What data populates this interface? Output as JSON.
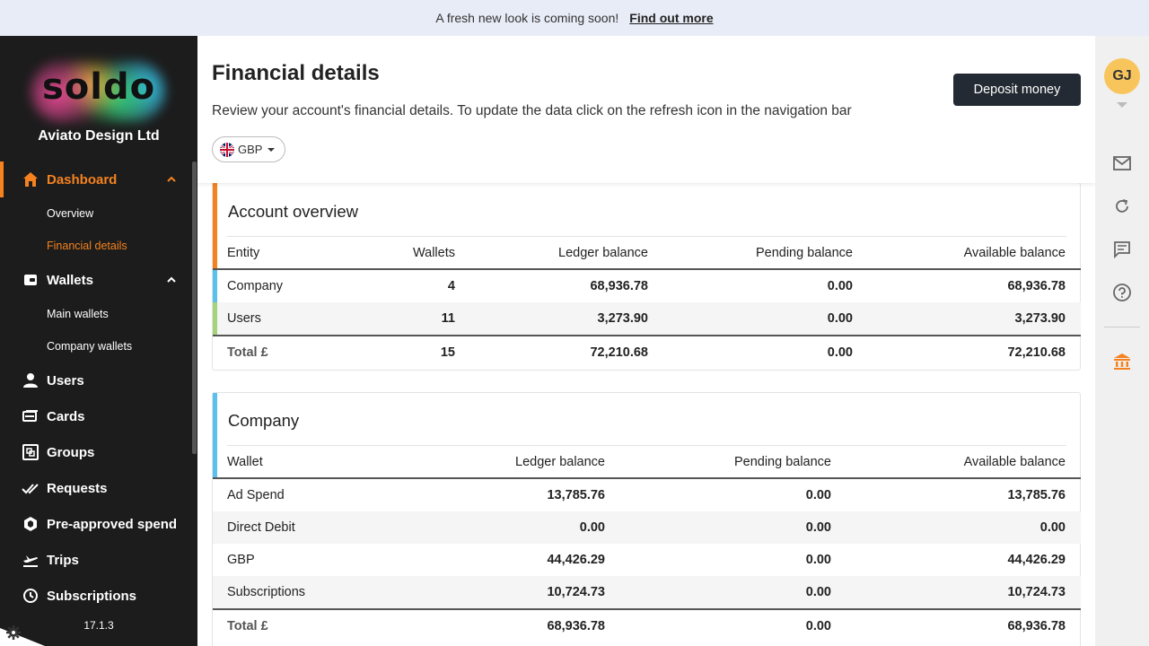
{
  "banner": {
    "text": "A fresh new look is coming soon!",
    "link": "Find out more"
  },
  "sidebar": {
    "logo": "soldo",
    "company": "Aviato Design Ltd",
    "version": "17.1.3",
    "nav": {
      "dashboard": "Dashboard",
      "overview": "Overview",
      "financial_details": "Financial details",
      "wallets": "Wallets",
      "main_wallets": "Main wallets",
      "company_wallets": "Company wallets",
      "users": "Users",
      "cards": "Cards",
      "groups": "Groups",
      "requests": "Requests",
      "pre_approved": "Pre-approved spend",
      "trips": "Trips",
      "subscriptions": "Subscriptions"
    }
  },
  "header": {
    "title": "Financial details",
    "description": "Review your account's financial details. To update the data click on the refresh icon in the navigation bar",
    "deposit_label": "Deposit money",
    "currency": "GBP"
  },
  "account_overview": {
    "title": "Account overview",
    "columns": [
      "Entity",
      "Wallets",
      "Ledger balance",
      "Pending balance",
      "Available balance"
    ],
    "rows": [
      {
        "entity": "Company",
        "wallets": "4",
        "ledger": "68,936.78",
        "pending": "0.00",
        "available": "68,936.78"
      },
      {
        "entity": "Users",
        "wallets": "11",
        "ledger": "3,273.90",
        "pending": "0.00",
        "available": "3,273.90"
      }
    ],
    "total": {
      "label": "Total £",
      "wallets": "15",
      "ledger": "72,210.68",
      "pending": "0.00",
      "available": "72,210.68"
    }
  },
  "company": {
    "title": "Company",
    "columns": [
      "Wallet",
      "Ledger balance",
      "Pending balance",
      "Available balance"
    ],
    "rows": [
      {
        "wallet": "Ad Spend",
        "ledger": "13,785.76",
        "pending": "0.00",
        "available": "13,785.76"
      },
      {
        "wallet": "Direct Debit",
        "ledger": "0.00",
        "pending": "0.00",
        "available": "0.00"
      },
      {
        "wallet": "GBP",
        "ledger": "44,426.29",
        "pending": "0.00",
        "available": "44,426.29"
      },
      {
        "wallet": "Subscriptions",
        "ledger": "10,724.73",
        "pending": "0.00",
        "available": "10,724.73"
      }
    ],
    "total": {
      "label": "Total £",
      "ledger": "68,936.78",
      "pending": "0.00",
      "available": "68,936.78"
    }
  },
  "rail": {
    "avatar": "GJ"
  },
  "colors": {
    "accent": "#f5821f",
    "company_marker": "#5bc0eb",
    "users_marker": "#a3d47c",
    "sidebar_bg": "#1c1c1c",
    "banner_bg": "#e8ecf6"
  }
}
